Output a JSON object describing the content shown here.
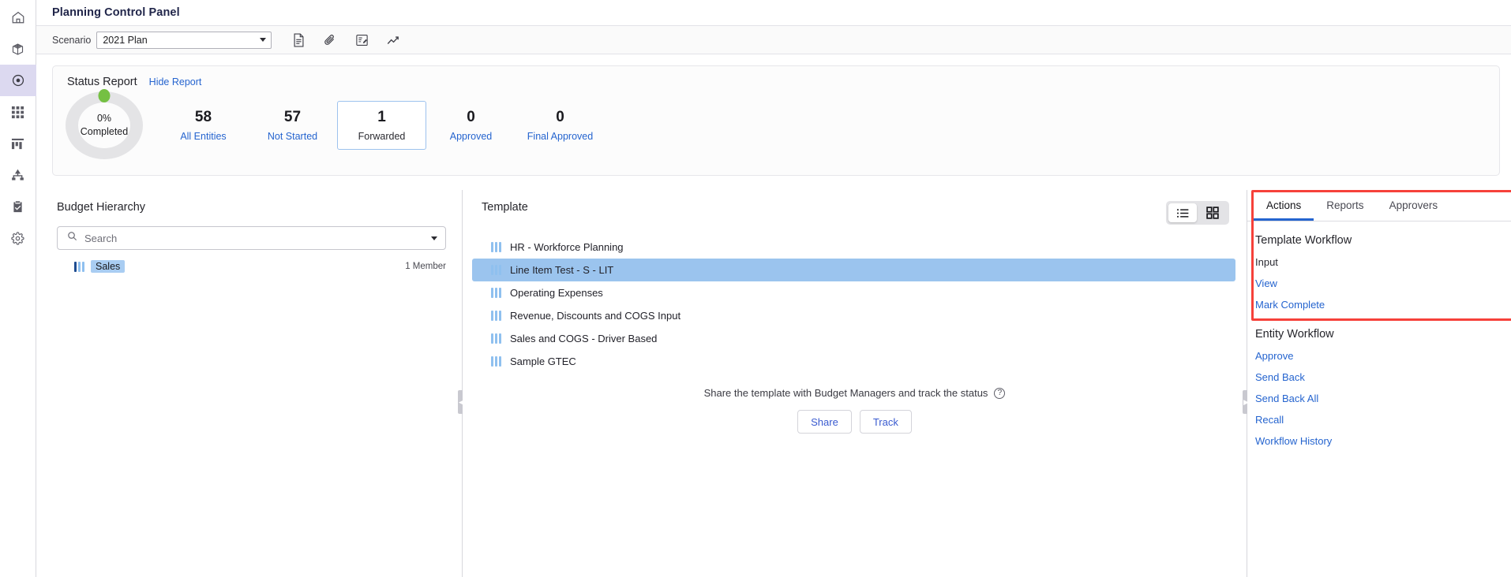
{
  "sidebar": {
    "items": [
      {
        "name": "home",
        "label": "Home"
      },
      {
        "name": "cube",
        "label": "Models"
      },
      {
        "name": "target",
        "label": "Planning Control Panel"
      },
      {
        "name": "grid",
        "label": "Grids"
      },
      {
        "name": "bar-chart",
        "label": "Reports"
      },
      {
        "name": "hierarchy",
        "label": "Hierarchy"
      },
      {
        "name": "clipboard-check",
        "label": "Tasks"
      },
      {
        "name": "gear",
        "label": "Settings"
      }
    ],
    "active_index": 2
  },
  "header": {
    "title": "Planning Control Panel"
  },
  "toolbar": {
    "scenario_label": "Scenario",
    "scenario_value": "2021 Plan",
    "icons": [
      {
        "name": "document-icon",
        "glyph": "document"
      },
      {
        "name": "attachment-icon",
        "glyph": "paperclip"
      },
      {
        "name": "annotate-icon",
        "glyph": "note-pencil"
      },
      {
        "name": "trend-chart-icon",
        "glyph": "trend"
      }
    ]
  },
  "status_report": {
    "title": "Status Report",
    "toggle_link": "Hide Report",
    "donut": {
      "percent_text": "0%",
      "status_text": "Completed",
      "percent_value": 0,
      "track_color": "#e4e4e6",
      "indicator_color": "#75c043"
    },
    "tiles": [
      {
        "value": "58",
        "label": "All Entities",
        "selected": false
      },
      {
        "value": "57",
        "label": "Not Started",
        "selected": false
      },
      {
        "value": "1",
        "label": "Forwarded",
        "selected": true
      },
      {
        "value": "0",
        "label": "Approved",
        "selected": false
      },
      {
        "value": "0",
        "label": "Final Approved",
        "selected": false
      }
    ]
  },
  "budget_hierarchy": {
    "title": "Budget Hierarchy",
    "search_placeholder": "Search",
    "nodes": [
      {
        "label": "Sales",
        "members": "1 Member",
        "selected": true
      }
    ]
  },
  "template_panel": {
    "title": "Template",
    "view_modes": [
      {
        "name": "list-view",
        "active": true
      },
      {
        "name": "grid-view",
        "active": false
      }
    ],
    "items": [
      {
        "label": "HR - Workforce Planning",
        "selected": false
      },
      {
        "label": "Line Item Test - S - LIT",
        "selected": true
      },
      {
        "label": "Operating Expenses",
        "selected": false
      },
      {
        "label": "Revenue, Discounts and COGS Input",
        "selected": false
      },
      {
        "label": "Sales and COGS - Driver Based",
        "selected": false
      },
      {
        "label": "Sample GTEC",
        "selected": false
      }
    ],
    "share_text": "Share the template with Budget Managers and track the status",
    "help_glyph": "?",
    "buttons": [
      {
        "label": "Share"
      },
      {
        "label": "Track"
      }
    ]
  },
  "right_panel": {
    "tabs": [
      {
        "label": "Actions",
        "active": true
      },
      {
        "label": "Reports",
        "active": false
      },
      {
        "label": "Approvers",
        "active": false
      }
    ],
    "sections": [
      {
        "title": "Template Workflow",
        "links": [
          {
            "label": "Input"
          },
          {
            "label": "View"
          },
          {
            "label": "Mark Complete"
          }
        ]
      },
      {
        "title": "Entity Workflow",
        "links": [
          {
            "label": "Approve"
          },
          {
            "label": "Send Back"
          },
          {
            "label": "Send Back All"
          },
          {
            "label": "Recall"
          },
          {
            "label": "Workflow History"
          }
        ]
      }
    ],
    "annotation_color": "#f6413a"
  }
}
